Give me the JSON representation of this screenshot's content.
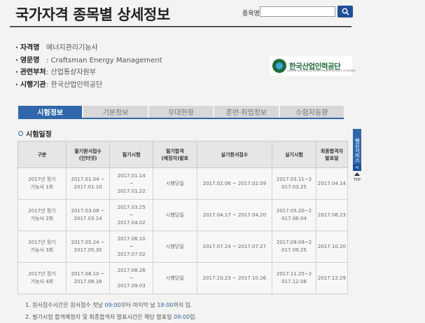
{
  "header": {
    "title": "국가자격 종목별 상세정보",
    "search_label": "종목명",
    "search_value": "",
    "search_placeholder": ""
  },
  "info": [
    {
      "key": "자격명",
      "value": "에너지관리기능사"
    },
    {
      "key": "영문명",
      "value": ": Craftsman Energy Management"
    },
    {
      "key": "관련부처",
      "value": ": 산업통상자원부"
    },
    {
      "key": "시행기관",
      "value": ": 한국산업인력공단"
    }
  ],
  "logo": {
    "text": "한국산업인력공단",
    "sub": "HUMAN RESOURCES DEVELOPMENT SERVICE OF KOREA"
  },
  "tabs": [
    "시험정보",
    "기본정보",
    "우대현황",
    "훈련·취업정보",
    "수험자동향"
  ],
  "section_title": "시험일정",
  "table": {
    "headers": [
      {
        "l1": "구분",
        "l2": ""
      },
      {
        "l1": "필기원서접수",
        "l2": "(인터넷)"
      },
      {
        "l1": "필기시험",
        "l2": ""
      },
      {
        "l1": "필기합격",
        "l2": "(예정자)발표"
      },
      {
        "l1": "실기원서접수",
        "l2": ""
      },
      {
        "l1": "실기시험",
        "l2": ""
      },
      {
        "l1": "최종합격자",
        "l2": "발표일"
      }
    ],
    "rows": [
      {
        "category": {
          "l1": "2017년 정기",
          "l2": "기능사 1회"
        },
        "written_app": {
          "l1": "2017.01.04 ~",
          "l2": "2017.01.10"
        },
        "written_exam": {
          "l1": "2017.01.14",
          "l2": "~",
          "l3": "2017.01.22"
        },
        "written_pass": "시행당일",
        "practical_app": "2017.02.06 ~ 2017.02.09",
        "practical_exam": {
          "l1": "2017.03.11~2",
          "l2": "017.03.25"
        },
        "final": "2017.04.14"
      },
      {
        "category": {
          "l1": "2017년 정기",
          "l2": "기능사 2회"
        },
        "written_app": {
          "l1": "2017.03.08 ~",
          "l2": "2017.03.14"
        },
        "written_exam": {
          "l1": "2017.03.25",
          "l2": "~",
          "l3": "2017.04.02"
        },
        "written_pass": "시행당일",
        "practical_app": "2017.04.17 ~ 2017.04.20",
        "practical_exam": {
          "l1": "2017.05.20~2",
          "l2": "017.06.04"
        },
        "final": "2017.06.23"
      },
      {
        "category": {
          "l1": "2017년 정기",
          "l2": "기능사 3회"
        },
        "written_app": {
          "l1": "2017.05.24 ~",
          "l2": "2017.05.30"
        },
        "written_exam": {
          "l1": "2017.06.10",
          "l2": "~",
          "l3": "2017.07.02"
        },
        "written_pass": "시행당일",
        "practical_app": "2017.07.24 ~ 2017.07.27",
        "practical_exam": {
          "l1": "2017.09.09~2",
          "l2": "017.09.25"
        },
        "final": "2017.10.20"
      },
      {
        "category": {
          "l1": "2017년 정기",
          "l2": "기능사 4회"
        },
        "written_app": {
          "l1": "2017.08.10 ~",
          "l2": "2017.08.16"
        },
        "written_exam": {
          "l1": "2017.08.26",
          "l2": "~",
          "l3": "2017.09.03"
        },
        "written_pass": "시행당일",
        "practical_app": "2017.10.23 ~ 2017.10.26",
        "practical_exam": {
          "l1": "2017.11.25~2",
          "l2": "017.12.08"
        },
        "final": "2017.12.29"
      }
    ]
  },
  "quick": {
    "label": "빠른서비스",
    "arrow": "<",
    "top": "TOP"
  },
  "notes": {
    "n1_a": "1. 원서접수시간은 원서접수 첫날 ",
    "n1_b": "09:00",
    "n1_c": "부터 마지막 날 ",
    "n1_d": "18:00",
    "n1_e": "까지 임.",
    "n2_a": "2. 필기시험 합격예정자 및 최종합격자 발표시간은 해당 발표일 ",
    "n2_b": "09:00",
    "n2_c": "임."
  },
  "colors": {
    "accent": "#2f67aa",
    "search_button": "#1f4f98",
    "logo_green": "#1e6b3a"
  }
}
